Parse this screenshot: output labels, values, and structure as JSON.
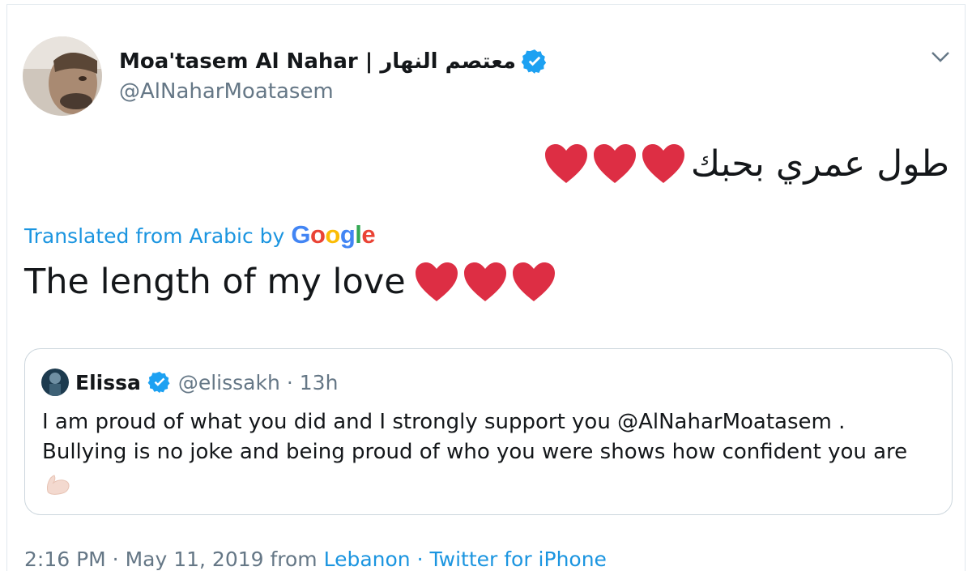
{
  "tweet": {
    "author_name": "Moa'tasem Al Nahar | معتصم النهار",
    "author_handle": "@AlNaharMoatasem",
    "text_arabic": "طول عمري بحبك",
    "heart_count_emoji": 3,
    "translated_label": "Translated from Arabic by",
    "google_letters": [
      "G",
      "o",
      "o",
      "g",
      "l",
      "e"
    ],
    "google_colors": [
      "#4285F4",
      "#EA4335",
      "#FBBC05",
      "#4285F4",
      "#34A853",
      "#EA4335"
    ],
    "translation_text": "The length of my love",
    "footer_time": "2:16 PM · May 11, 2019 from ",
    "footer_link": "Lebanon · Twitter for iPhone"
  },
  "quoted": {
    "name": "Elissa",
    "handle": "@elissakh",
    "dot": "·",
    "time": "13h",
    "line1": "I am proud of what you did and I strongly support you @AlNaharMoatasem .",
    "line2": "Bullying is no joke and being proud of who you were shows how confident you are"
  },
  "colors": {
    "verified": "#1da1f2",
    "heart": "#dd2e44",
    "link": "#1b95e0",
    "muted": "#657786"
  }
}
